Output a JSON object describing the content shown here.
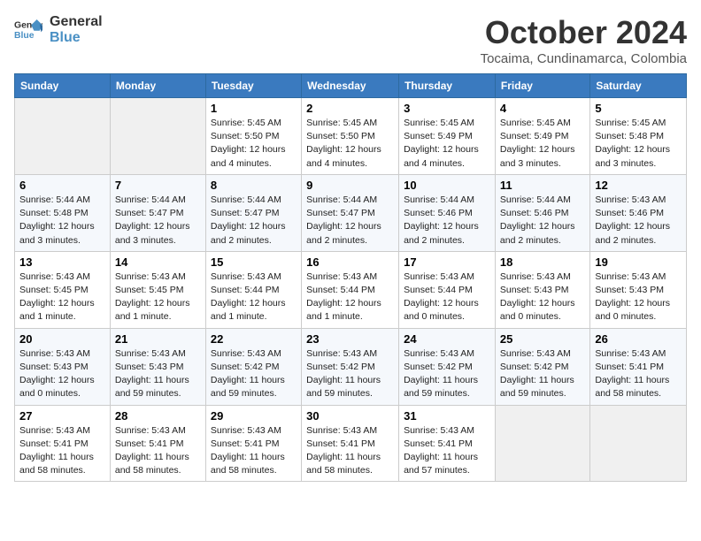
{
  "header": {
    "logo_line1": "General",
    "logo_line2": "Blue",
    "month": "October 2024",
    "location": "Tocaima, Cundinamarca, Colombia"
  },
  "days_of_week": [
    "Sunday",
    "Monday",
    "Tuesday",
    "Wednesday",
    "Thursday",
    "Friday",
    "Saturday"
  ],
  "weeks": [
    [
      {
        "day": "",
        "empty": true
      },
      {
        "day": "",
        "empty": true
      },
      {
        "day": "1",
        "info": "Sunrise: 5:45 AM\nSunset: 5:50 PM\nDaylight: 12 hours\nand 4 minutes."
      },
      {
        "day": "2",
        "info": "Sunrise: 5:45 AM\nSunset: 5:50 PM\nDaylight: 12 hours\nand 4 minutes."
      },
      {
        "day": "3",
        "info": "Sunrise: 5:45 AM\nSunset: 5:49 PM\nDaylight: 12 hours\nand 4 minutes."
      },
      {
        "day": "4",
        "info": "Sunrise: 5:45 AM\nSunset: 5:49 PM\nDaylight: 12 hours\nand 3 minutes."
      },
      {
        "day": "5",
        "info": "Sunrise: 5:45 AM\nSunset: 5:48 PM\nDaylight: 12 hours\nand 3 minutes."
      }
    ],
    [
      {
        "day": "6",
        "info": "Sunrise: 5:44 AM\nSunset: 5:48 PM\nDaylight: 12 hours\nand 3 minutes."
      },
      {
        "day": "7",
        "info": "Sunrise: 5:44 AM\nSunset: 5:47 PM\nDaylight: 12 hours\nand 3 minutes."
      },
      {
        "day": "8",
        "info": "Sunrise: 5:44 AM\nSunset: 5:47 PM\nDaylight: 12 hours\nand 2 minutes."
      },
      {
        "day": "9",
        "info": "Sunrise: 5:44 AM\nSunset: 5:47 PM\nDaylight: 12 hours\nand 2 minutes."
      },
      {
        "day": "10",
        "info": "Sunrise: 5:44 AM\nSunset: 5:46 PM\nDaylight: 12 hours\nand 2 minutes."
      },
      {
        "day": "11",
        "info": "Sunrise: 5:44 AM\nSunset: 5:46 PM\nDaylight: 12 hours\nand 2 minutes."
      },
      {
        "day": "12",
        "info": "Sunrise: 5:43 AM\nSunset: 5:46 PM\nDaylight: 12 hours\nand 2 minutes."
      }
    ],
    [
      {
        "day": "13",
        "info": "Sunrise: 5:43 AM\nSunset: 5:45 PM\nDaylight: 12 hours\nand 1 minute."
      },
      {
        "day": "14",
        "info": "Sunrise: 5:43 AM\nSunset: 5:45 PM\nDaylight: 12 hours\nand 1 minute."
      },
      {
        "day": "15",
        "info": "Sunrise: 5:43 AM\nSunset: 5:44 PM\nDaylight: 12 hours\nand 1 minute."
      },
      {
        "day": "16",
        "info": "Sunrise: 5:43 AM\nSunset: 5:44 PM\nDaylight: 12 hours\nand 1 minute."
      },
      {
        "day": "17",
        "info": "Sunrise: 5:43 AM\nSunset: 5:44 PM\nDaylight: 12 hours\nand 0 minutes."
      },
      {
        "day": "18",
        "info": "Sunrise: 5:43 AM\nSunset: 5:43 PM\nDaylight: 12 hours\nand 0 minutes."
      },
      {
        "day": "19",
        "info": "Sunrise: 5:43 AM\nSunset: 5:43 PM\nDaylight: 12 hours\nand 0 minutes."
      }
    ],
    [
      {
        "day": "20",
        "info": "Sunrise: 5:43 AM\nSunset: 5:43 PM\nDaylight: 12 hours\nand 0 minutes."
      },
      {
        "day": "21",
        "info": "Sunrise: 5:43 AM\nSunset: 5:43 PM\nDaylight: 11 hours\nand 59 minutes."
      },
      {
        "day": "22",
        "info": "Sunrise: 5:43 AM\nSunset: 5:42 PM\nDaylight: 11 hours\nand 59 minutes."
      },
      {
        "day": "23",
        "info": "Sunrise: 5:43 AM\nSunset: 5:42 PM\nDaylight: 11 hours\nand 59 minutes."
      },
      {
        "day": "24",
        "info": "Sunrise: 5:43 AM\nSunset: 5:42 PM\nDaylight: 11 hours\nand 59 minutes."
      },
      {
        "day": "25",
        "info": "Sunrise: 5:43 AM\nSunset: 5:42 PM\nDaylight: 11 hours\nand 59 minutes."
      },
      {
        "day": "26",
        "info": "Sunrise: 5:43 AM\nSunset: 5:41 PM\nDaylight: 11 hours\nand 58 minutes."
      }
    ],
    [
      {
        "day": "27",
        "info": "Sunrise: 5:43 AM\nSunset: 5:41 PM\nDaylight: 11 hours\nand 58 minutes."
      },
      {
        "day": "28",
        "info": "Sunrise: 5:43 AM\nSunset: 5:41 PM\nDaylight: 11 hours\nand 58 minutes."
      },
      {
        "day": "29",
        "info": "Sunrise: 5:43 AM\nSunset: 5:41 PM\nDaylight: 11 hours\nand 58 minutes."
      },
      {
        "day": "30",
        "info": "Sunrise: 5:43 AM\nSunset: 5:41 PM\nDaylight: 11 hours\nand 58 minutes."
      },
      {
        "day": "31",
        "info": "Sunrise: 5:43 AM\nSunset: 5:41 PM\nDaylight: 11 hours\nand 57 minutes."
      },
      {
        "day": "",
        "empty": true
      },
      {
        "day": "",
        "empty": true
      }
    ]
  ]
}
